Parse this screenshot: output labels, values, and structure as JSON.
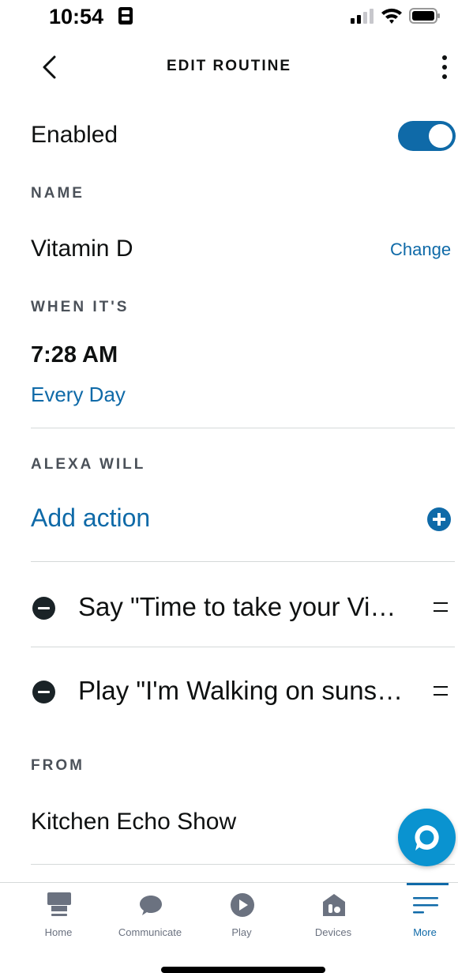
{
  "status_bar": {
    "time": "10:54"
  },
  "header": {
    "title": "EDIT ROUTINE"
  },
  "enabled": {
    "label": "Enabled",
    "value": true
  },
  "name_section": {
    "heading": "NAME",
    "value": "Vitamin D",
    "change_label": "Change"
  },
  "when_section": {
    "heading": "WHEN IT'S",
    "time": "7:28 AM",
    "repeat": "Every Day"
  },
  "actions_section": {
    "heading": "ALEXA WILL",
    "add_label": "Add action",
    "items": [
      {
        "label": "Say \"Time to take your Vi…"
      },
      {
        "label": "Play \"I'm Walking on suns…"
      }
    ]
  },
  "from_section": {
    "heading": "FROM",
    "device": "Kitchen Echo Show"
  },
  "tabbar": {
    "tabs": [
      {
        "label": "Home",
        "icon": "home-icon"
      },
      {
        "label": "Communicate",
        "icon": "chat-bubble-icon"
      },
      {
        "label": "Play",
        "icon": "play-icon"
      },
      {
        "label": "Devices",
        "icon": "devices-icon"
      },
      {
        "label": "More",
        "icon": "hamburger-icon",
        "active": true
      }
    ]
  },
  "colors": {
    "accent": "#0f6aa8",
    "alexa_button": "#0a93d0",
    "text": "#0f1111",
    "section": "#4b5159"
  }
}
